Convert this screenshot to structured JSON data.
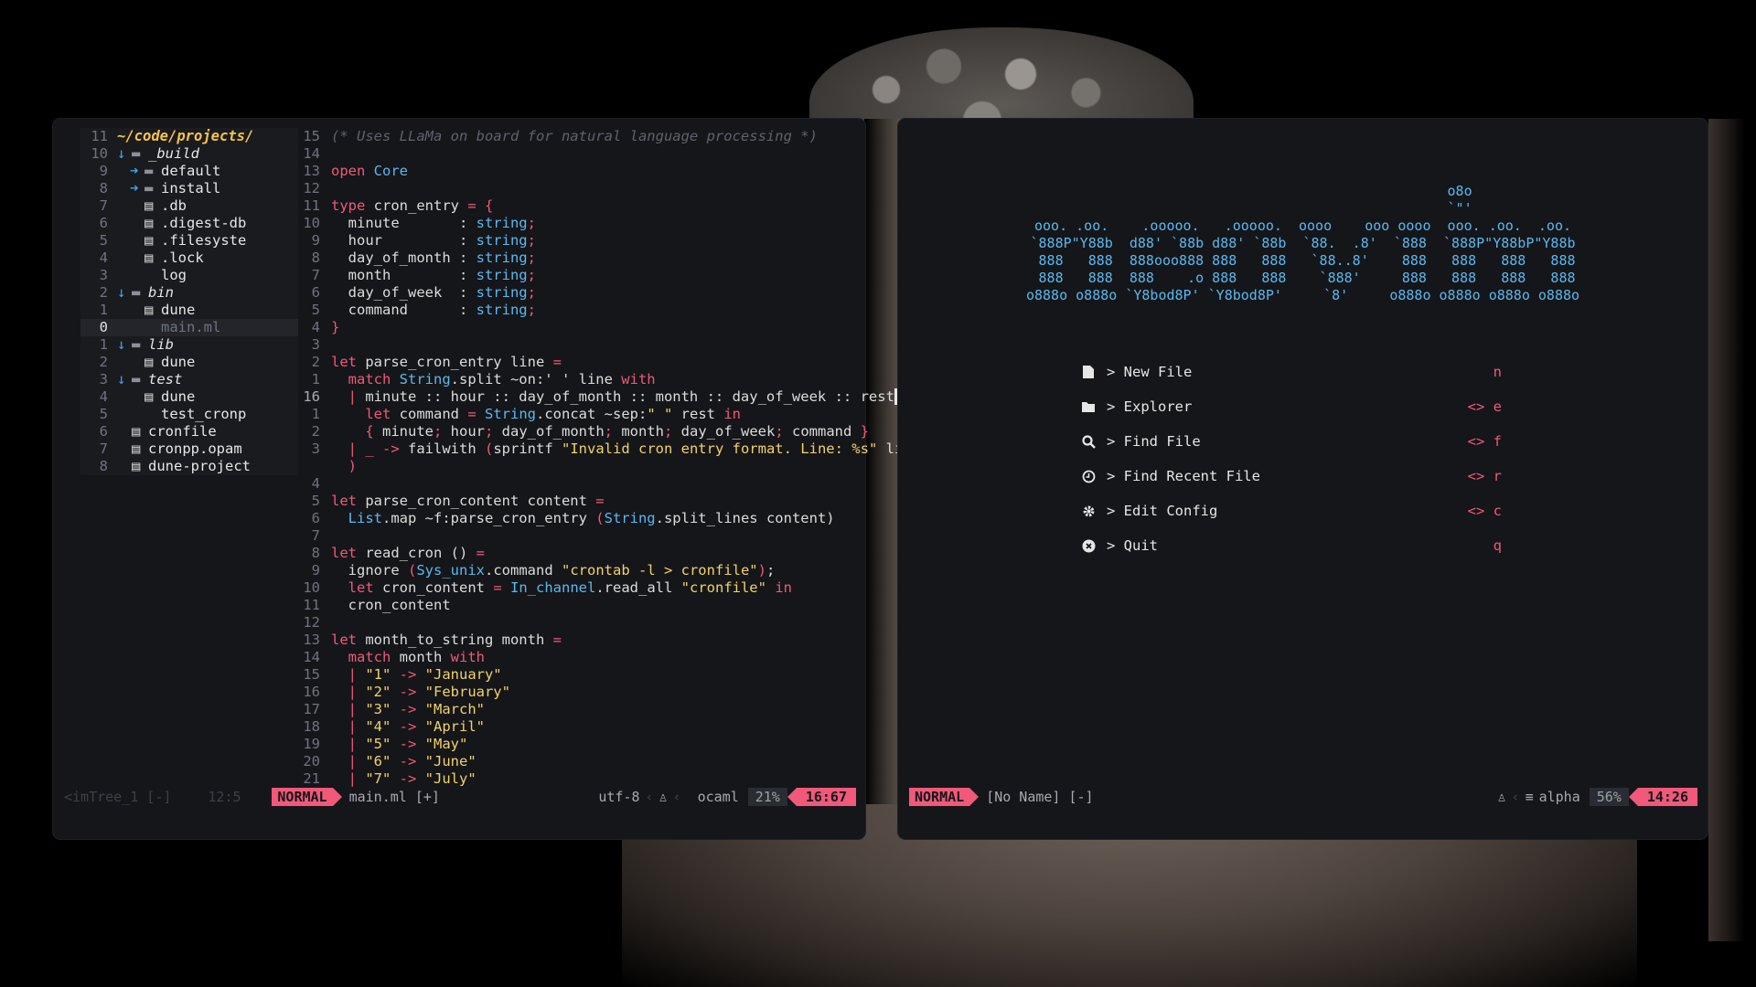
{
  "left_pane": {
    "tree": [
      {
        "num": "11",
        "arrow": "",
        "icon": "",
        "text": "~/code/projects/",
        "kind": "root"
      },
      {
        "num": "10",
        "arrow": "▼",
        "icon": "folder",
        "text": "_build",
        "kind": "dir"
      },
      {
        "num": "9",
        "arrow": "▶",
        "icon": "folder",
        "text": "default",
        "kind": "file"
      },
      {
        "num": "8",
        "arrow": "▶",
        "icon": "folder",
        "text": "install",
        "kind": "file"
      },
      {
        "num": "7",
        "arrow": "",
        "icon": "file",
        "text": ".db",
        "kind": "file"
      },
      {
        "num": "6",
        "arrow": "",
        "icon": "file",
        "text": ".digest-db",
        "kind": "file"
      },
      {
        "num": "5",
        "arrow": "",
        "icon": "file",
        "text": ".filesyste",
        "kind": "file"
      },
      {
        "num": "4",
        "arrow": "",
        "icon": "file",
        "text": ".lock",
        "kind": "file"
      },
      {
        "num": "3",
        "arrow": "",
        "icon": "",
        "text": "log",
        "kind": "file"
      },
      {
        "num": "2",
        "arrow": "▼",
        "icon": "folder",
        "text": "bin",
        "kind": "dir"
      },
      {
        "num": "1",
        "arrow": "",
        "icon": "file",
        "text": "dune",
        "kind": "file"
      },
      {
        "num": "0",
        "arrow": "",
        "icon": "",
        "text": "main.ml",
        "kind": "dim"
      },
      {
        "num": "1",
        "arrow": "▼",
        "icon": "folder",
        "text": "lib",
        "kind": "dir"
      },
      {
        "num": "2",
        "arrow": "",
        "icon": "file",
        "text": "dune",
        "kind": "file"
      },
      {
        "num": "3",
        "arrow": "▼",
        "icon": "folder",
        "text": "test",
        "kind": "dir"
      },
      {
        "num": "4",
        "arrow": "",
        "icon": "file",
        "text": "dune",
        "kind": "file"
      },
      {
        "num": "5",
        "arrow": "",
        "icon": "",
        "text": "test_cronp",
        "kind": "file"
      },
      {
        "num": "6",
        "arrow": "",
        "icon": "file",
        "text": "cronfile",
        "kind": "file"
      },
      {
        "num": "7",
        "arrow": "",
        "icon": "file",
        "text": "cronpp.opam",
        "kind": "file"
      },
      {
        "num": "8",
        "arrow": "",
        "icon": "file",
        "text": "dune-project",
        "kind": "file"
      }
    ],
    "code": [
      {
        "num": "15",
        "tokens": [
          [
            "c",
            "(* Uses LLaMa on board for natural language processing *)"
          ]
        ]
      },
      {
        "num": "14",
        "tokens": []
      },
      {
        "num": "13",
        "tokens": [
          [
            "k",
            "open"
          ],
          [
            "",
            ""
          ],
          [
            "m",
            " Core"
          ]
        ]
      },
      {
        "num": "12",
        "tokens": []
      },
      {
        "num": "11",
        "tokens": [
          [
            "k",
            "type"
          ],
          [
            "",
            " cron_entry "
          ],
          [
            "k",
            "= {"
          ]
        ]
      },
      {
        "num": "10",
        "tokens": [
          [
            "",
            "  minute       : "
          ],
          [
            "m",
            "string"
          ],
          [
            "k",
            ";"
          ]
        ]
      },
      {
        "num": "9",
        "tokens": [
          [
            "",
            "  hour         : "
          ],
          [
            "m",
            "string"
          ],
          [
            "k",
            ";"
          ]
        ]
      },
      {
        "num": "8",
        "tokens": [
          [
            "",
            "  day_of_month : "
          ],
          [
            "m",
            "string"
          ],
          [
            "k",
            ";"
          ]
        ]
      },
      {
        "num": "7",
        "tokens": [
          [
            "",
            "  month        : "
          ],
          [
            "m",
            "string"
          ],
          [
            "k",
            ";"
          ]
        ]
      },
      {
        "num": "6",
        "tokens": [
          [
            "",
            "  day_of_week  : "
          ],
          [
            "m",
            "string"
          ],
          [
            "k",
            ";"
          ]
        ]
      },
      {
        "num": "5",
        "tokens": [
          [
            "",
            "  command      : "
          ],
          [
            "m",
            "string"
          ],
          [
            "k",
            ";"
          ]
        ]
      },
      {
        "num": "4",
        "tokens": [
          [
            "k",
            "}"
          ]
        ]
      },
      {
        "num": "3",
        "tokens": []
      },
      {
        "num": "2",
        "tokens": [
          [
            "k",
            "let"
          ],
          [
            "",
            " parse_cron_entry line "
          ],
          [
            "k",
            "="
          ]
        ]
      },
      {
        "num": "1",
        "tokens": [
          [
            "k",
            "  match "
          ],
          [
            "m",
            "String"
          ],
          [
            "",
            ".split ~on:' ' line "
          ],
          [
            "k",
            "with"
          ]
        ]
      },
      {
        "num": "16",
        "cur": true,
        "tokens": [
          [
            "k",
            "  | "
          ],
          [
            "",
            "minute :: hour :: day_of_month :: month :: day_of_week :: rest"
          ],
          [
            "cursor",
            " "
          ],
          [
            "k",
            "->"
          ]
        ]
      },
      {
        "num": "1",
        "tokens": [
          [
            "k",
            "    let"
          ],
          [
            "",
            " command "
          ],
          [
            "k",
            "="
          ],
          [
            "m",
            " String"
          ],
          [
            "",
            ".concat ~sep:"
          ],
          [
            "s",
            "\" \""
          ],
          [
            "",
            " rest "
          ],
          [
            "k",
            "in"
          ]
        ]
      },
      {
        "num": "2",
        "tokens": [
          [
            "k",
            "    { "
          ],
          [
            "",
            "minute"
          ],
          [
            "k",
            "; "
          ],
          [
            "",
            "hour"
          ],
          [
            "k",
            "; "
          ],
          [
            "",
            "day_of_month"
          ],
          [
            "k",
            "; "
          ],
          [
            "",
            "month"
          ],
          [
            "k",
            "; "
          ],
          [
            "",
            "day_of_week"
          ],
          [
            "k",
            "; "
          ],
          [
            "",
            "command "
          ],
          [
            "k",
            "}"
          ]
        ]
      },
      {
        "num": "3",
        "tokens": [
          [
            "k",
            "  | _ -> "
          ],
          [
            "",
            "failwith "
          ],
          [
            "k",
            "("
          ],
          [
            "",
            "sprintf "
          ],
          [
            "s",
            "\"Invalid cron entry format. Line: %s\""
          ],
          [
            "",
            " line"
          ]
        ]
      },
      {
        "num": "",
        "tokens": [
          [
            "k",
            "  )"
          ]
        ]
      },
      {
        "num": "4",
        "tokens": []
      },
      {
        "num": "5",
        "tokens": [
          [
            "k",
            "let"
          ],
          [
            "",
            " parse_cron_content content "
          ],
          [
            "k",
            "="
          ]
        ]
      },
      {
        "num": "6",
        "tokens": [
          [
            "m",
            "  List"
          ],
          [
            "",
            ".map ~f:parse_cron_entry "
          ],
          [
            "k",
            "("
          ],
          [
            "m",
            "String"
          ],
          [
            "",
            ".split_lines content)"
          ]
        ]
      },
      {
        "num": "7",
        "tokens": []
      },
      {
        "num": "8",
        "tokens": [
          [
            "k",
            "let"
          ],
          [
            "",
            " read_cron () "
          ],
          [
            "k",
            "="
          ]
        ]
      },
      {
        "num": "9",
        "tokens": [
          [
            "",
            "  ignore "
          ],
          [
            "k",
            "("
          ],
          [
            "m",
            "Sys_unix"
          ],
          [
            "",
            ".command "
          ],
          [
            "s",
            "\"crontab -l > cronfile\""
          ],
          [
            "k",
            ")"
          ],
          [
            "",
            ";"
          ]
        ]
      },
      {
        "num": "10",
        "tokens": [
          [
            "k",
            "  let"
          ],
          [
            "",
            " cron_content "
          ],
          [
            "k",
            "="
          ],
          [
            "m",
            " In_channel"
          ],
          [
            "",
            ".read_all "
          ],
          [
            "s",
            "\"cronfile\""
          ],
          [
            "k",
            " in"
          ]
        ]
      },
      {
        "num": "11",
        "tokens": [
          [
            "",
            "  cron_content"
          ]
        ]
      },
      {
        "num": "12",
        "tokens": []
      },
      {
        "num": "13",
        "tokens": [
          [
            "k",
            "let"
          ],
          [
            "",
            " month_to_string month "
          ],
          [
            "k",
            "="
          ]
        ]
      },
      {
        "num": "14",
        "tokens": [
          [
            "k",
            "  match"
          ],
          [
            "",
            " month "
          ],
          [
            "k",
            "with"
          ]
        ]
      },
      {
        "num": "15",
        "tokens": [
          [
            "k",
            "  | "
          ],
          [
            "s",
            "\"1\""
          ],
          [
            "k",
            " -> "
          ],
          [
            "s",
            "\"January\""
          ]
        ]
      },
      {
        "num": "16",
        "tokens": [
          [
            "k",
            "  | "
          ],
          [
            "s",
            "\"2\""
          ],
          [
            "k",
            " -> "
          ],
          [
            "s",
            "\"February\""
          ]
        ]
      },
      {
        "num": "17",
        "tokens": [
          [
            "k",
            "  | "
          ],
          [
            "s",
            "\"3\""
          ],
          [
            "k",
            " -> "
          ],
          [
            "s",
            "\"March\""
          ]
        ]
      },
      {
        "num": "18",
        "tokens": [
          [
            "k",
            "  | "
          ],
          [
            "s",
            "\"4\""
          ],
          [
            "k",
            " -> "
          ],
          [
            "s",
            "\"April\""
          ]
        ]
      },
      {
        "num": "19",
        "tokens": [
          [
            "k",
            "  | "
          ],
          [
            "s",
            "\"5\""
          ],
          [
            "k",
            " -> "
          ],
          [
            "s",
            "\"May\""
          ]
        ]
      },
      {
        "num": "20",
        "tokens": [
          [
            "k",
            "  | "
          ],
          [
            "s",
            "\"6\""
          ],
          [
            "k",
            " -> "
          ],
          [
            "s",
            "\"June\""
          ]
        ]
      },
      {
        "num": "21",
        "tokens": [
          [
            "k",
            "  | "
          ],
          [
            "s",
            "\"7\""
          ],
          [
            "k",
            " -> "
          ],
          [
            "s",
            "\"July\""
          ]
        ]
      }
    ],
    "status": {
      "tree_name": "<imTree_1 [-]",
      "tree_pos": "12:5",
      "mode": "NORMAL",
      "file": "main.ml [+]",
      "encoding": "utf-8",
      "filetype": "ocaml",
      "percent": "21%",
      "position": "16:67"
    }
  },
  "right_pane": {
    "ascii_art": [
      "                                      o8o",
      "                                      `\"'",
      "ooo. .oo.    .ooooo.   .ooooo.  oooo    ooo oooo  ooo. .oo.  .oo.",
      "`888P\"Y88b  d88' `88b d88' `88b  `88.  .8'  `888  `888P\"Y88bP\"Y88b",
      " 888   888  888ooo888 888   888   `88..8'    888   888   888   888",
      " 888   888  888    .o 888   888    `888'     888   888   888   888",
      "o888o o888o `Y8bod8P' `Y8bod8P'     `8'     o888o o888o o888o o888o"
    ],
    "menu": [
      {
        "icon": "file-icon",
        "label": "> New File",
        "key": "n"
      },
      {
        "icon": "folder-icon",
        "label": "> Explorer",
        "key": "<> e"
      },
      {
        "icon": "search-icon",
        "label": "> Find File",
        "key": "<> f"
      },
      {
        "icon": "clock-icon",
        "label": "> Find Recent File",
        "key": "<> r"
      },
      {
        "icon": "gear-icon",
        "label": "> Edit Config",
        "key": "<> c"
      },
      {
        "icon": "close-icon",
        "label": "> Quit",
        "key": "q"
      }
    ],
    "status": {
      "mode": "NORMAL",
      "file": "[No Name] [-]",
      "keymap": "alpha",
      "percent": "56%",
      "position": "14:26"
    }
  },
  "colors": {
    "accent": "#f0597a",
    "module": "#5ab8f0",
    "string": "#f2d26a",
    "root": "#f5c34f",
    "background": "#151619"
  }
}
